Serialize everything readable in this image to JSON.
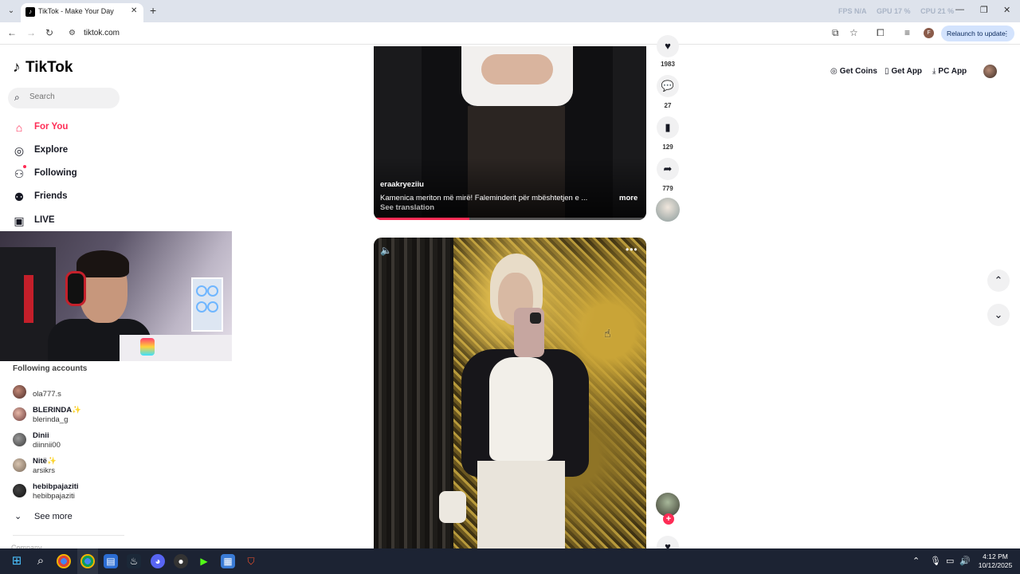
{
  "browser": {
    "tab_title": "TikTok - Make Your Day",
    "url": "tiktok.com",
    "relaunch_label": "Relaunch to update",
    "profile_initial": "F",
    "perf": {
      "fps": "FPS N/A",
      "gpu": "GPU 17 %",
      "cpu": "CPU 21 %"
    }
  },
  "sidebar": {
    "logo": "TikTok",
    "search_placeholder": "Search",
    "nav": [
      {
        "label": "For You",
        "icon": "home-icon"
      },
      {
        "label": "Explore",
        "icon": "compass-icon"
      },
      {
        "label": "Following",
        "icon": "user-follow-icon"
      },
      {
        "label": "Friends",
        "icon": "friends-icon"
      },
      {
        "label": "LIVE",
        "icon": "live-icon"
      }
    ],
    "following_title": "Following accounts",
    "accounts": [
      {
        "name": "",
        "handle": "ola777.s"
      },
      {
        "name": "BLERINDA✨",
        "handle": "blerinda_g"
      },
      {
        "name": "Dinii",
        "handle": "diinnii00"
      },
      {
        "name": "Nitë✨",
        "handle": "arsikrs"
      },
      {
        "name": "hebibpajaziti",
        "handle": "hebibpajaziti"
      }
    ],
    "see_more": "See more",
    "cut_off_text": "Company"
  },
  "header": {
    "get_coins": "Get Coins",
    "get_app": "Get App",
    "pc_app": "PC App"
  },
  "video1": {
    "username": "eraakryeziiu",
    "caption": "Kamenica meriton më mirë! Faleminderit për mbështetjen e ...",
    "more": "more",
    "translate": "See translation",
    "progress": 0.35,
    "likes": "1983",
    "comments": "27",
    "saves": "129",
    "shares": "779"
  },
  "video2": {
    "mute_icon": "volume-icon",
    "menu_icon": "more-dots-icon"
  },
  "taskbar": {
    "time": "4:12 PM",
    "date": "10/12/2025"
  },
  "colors": {
    "accent": "#fe2c55",
    "taskbar": "#1c2333"
  }
}
